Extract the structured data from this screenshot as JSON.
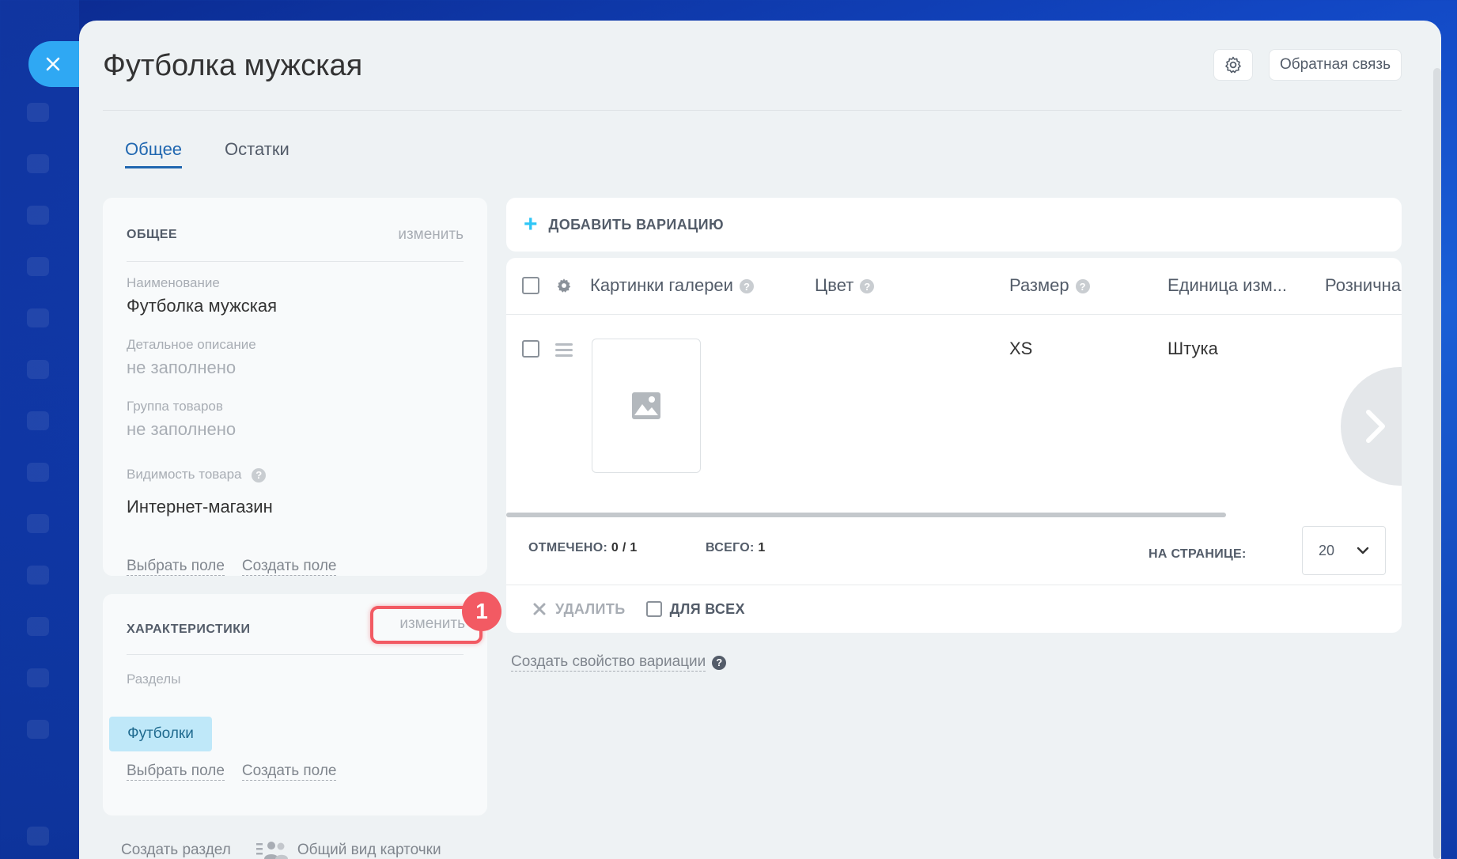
{
  "header": {
    "title": "Футболка мужская",
    "settings_icon": "gear-icon",
    "feedback_label": "Обратная связь"
  },
  "tabs": [
    {
      "label": "Общее",
      "active": true
    },
    {
      "label": "Остатки",
      "active": false
    }
  ],
  "general_card": {
    "heading": "ОБЩЕЕ",
    "edit_label": "изменить",
    "fields": [
      {
        "label": "Наименование",
        "value": "Футболка мужская"
      },
      {
        "label": "Детальное описание",
        "value": "не заполнено"
      },
      {
        "label": "Группа товаров",
        "value": "не заполнено"
      },
      {
        "label": "Видимость товара",
        "value": "Интернет-магазин"
      }
    ],
    "select_field": "Выбрать поле",
    "create_field": "Создать поле"
  },
  "chars_card": {
    "heading": "ХАРАКТЕРИСТИКИ",
    "edit_label": "изменить",
    "sections_label": "Разделы",
    "section_chip": "Футболки",
    "select_field": "Выбрать поле",
    "create_field": "Создать поле",
    "step_badge": "1"
  },
  "bottom_links": {
    "create_section": "Создать раздел",
    "card_view": "Общий вид карточки"
  },
  "variations": {
    "add_label": "ДОБАВИТЬ ВАРИАЦИЮ",
    "columns": [
      "Картинки галереи",
      "Цвет",
      "Размер",
      "Единица изм...",
      "Розничная"
    ],
    "row": {
      "size": "XS",
      "unit": "Штука"
    },
    "footer": {
      "checked_label": "ОТМЕЧЕНО:",
      "checked_value": "0 / 1",
      "total_label": "ВСЕГО:",
      "total_value": "1",
      "per_page_label": "НА СТРАНИЦЕ:",
      "per_page_value": "20"
    },
    "delete_label": "УДАЛИТЬ",
    "for_all_label": "ДЛЯ ВСЕХ",
    "create_property": "Создать свойство вариации"
  },
  "colors": {
    "accent": "#2067b0",
    "highlight": "#f25a63",
    "chip_bg": "#bfe8f9",
    "close_tab": "#2fa8f3"
  }
}
